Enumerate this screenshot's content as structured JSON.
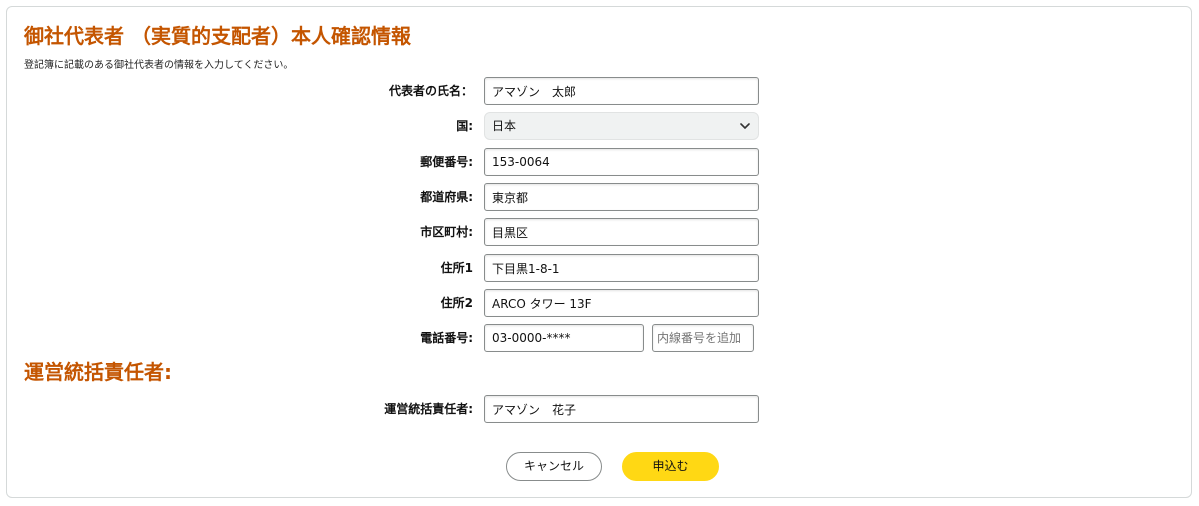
{
  "colors": {
    "heading": "#c45500",
    "primary_button": "#ffd814",
    "border": "#888c8c"
  },
  "page": {
    "title": "御社代表者 （実質的支配者）本人確認情報",
    "subtitle": "登記簿に記載のある御社代表者の情報を入力してください。"
  },
  "representative": {
    "name": {
      "label": "代表者の氏名：",
      "value": "アマゾン　太郎"
    },
    "country": {
      "label": "国:",
      "value": "日本",
      "icon": "chevron-down-icon"
    },
    "postal_code": {
      "label": "郵便番号:",
      "value": "153-0064"
    },
    "prefecture": {
      "label": "都道府県:",
      "value": "東京都"
    },
    "city": {
      "label": "市区町村:",
      "value": "目黒区"
    },
    "address1": {
      "label": "住所1",
      "value": "下目黒1-8-1"
    },
    "address2": {
      "label": "住所2",
      "value": "ARCO タワー 13F"
    },
    "phone": {
      "label": "電話番号:",
      "value": "03-0000-****",
      "extension_placeholder": "内線番号を追加"
    }
  },
  "operations": {
    "section_title": "運営統括責任者:",
    "manager": {
      "label": "運営統括責任者:",
      "value": "アマゾン　花子"
    }
  },
  "actions": {
    "cancel_label": "キャンセル",
    "submit_label": "申込む"
  }
}
